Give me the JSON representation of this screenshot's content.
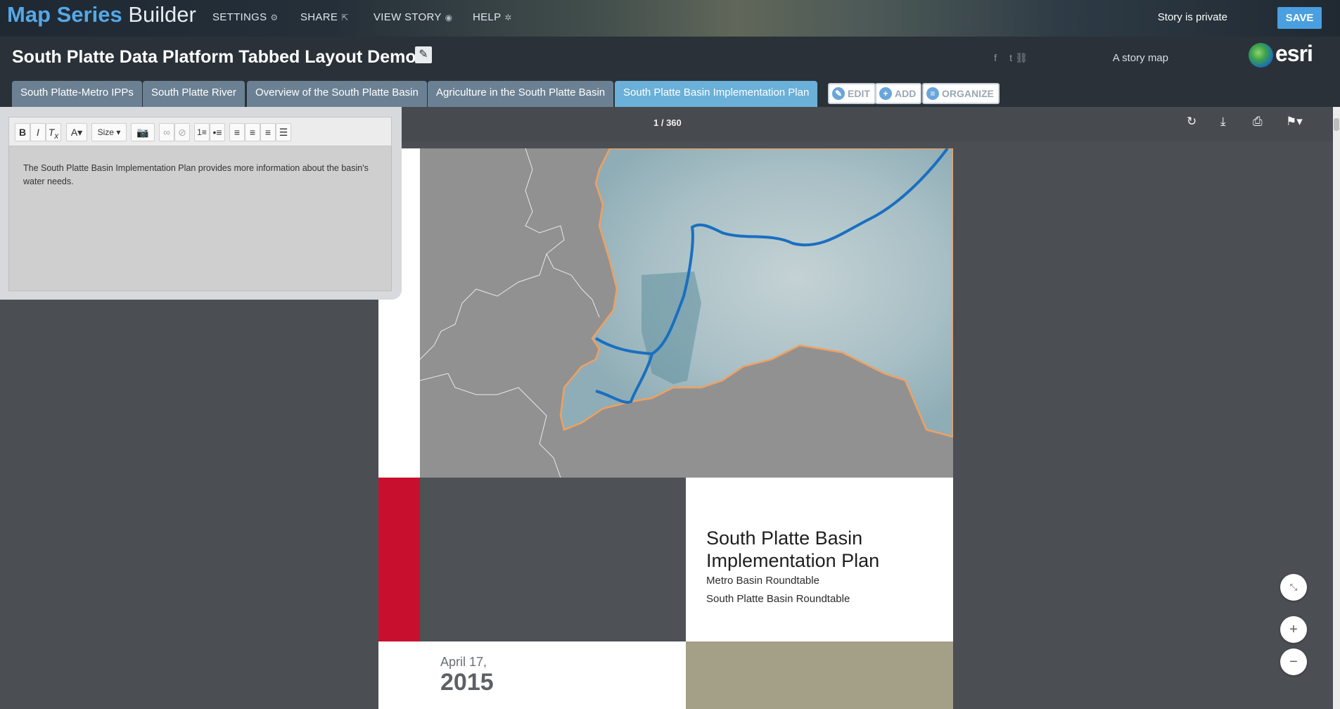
{
  "builder": {
    "brand_bold": "Map Series",
    "brand_light": "Builder",
    "nav": [
      {
        "label": "SETTINGS",
        "icon": "gears-icon"
      },
      {
        "label": "SHARE",
        "icon": "share-icon"
      },
      {
        "label": "VIEW STORY",
        "icon": "eye-icon"
      },
      {
        "label": "HELP",
        "icon": "lifebuoy-icon"
      }
    ],
    "status": "Story is private",
    "save_label": "SAVE"
  },
  "header": {
    "title": "South Platte Data Platform Tabbed Layout Demo",
    "tagline": "A story map",
    "esri_logo_text": "esri"
  },
  "tabs": [
    {
      "label": "South Platte-Metro IPPs",
      "active": false
    },
    {
      "label": "South Platte River",
      "active": false
    },
    {
      "label": "Overview of the South Platte Basin",
      "active": false
    },
    {
      "label": "Agriculture in the South Platte Basin",
      "active": false
    },
    {
      "label": "South Platte Basin Implementation Plan",
      "active": true
    }
  ],
  "tab_actions": {
    "edit": "EDIT",
    "add": "ADD",
    "organize": "ORGANIZE"
  },
  "editor": {
    "size_label": "Size",
    "text": "The South Platte Basin Implementation Plan provides more information about the basin's water needs."
  },
  "pdf": {
    "page_indicator": "1 / 360",
    "title": "South Platte Basin Implementation Plan",
    "subtitle1": "Metro Basin Roundtable",
    "subtitle2": "South Platte Basin Roundtable",
    "date": "April 17,",
    "year": "2015"
  },
  "colors": {
    "active_tab": "#6ab0d8",
    "tab": "#6b8193",
    "save": "#4a9fe0",
    "red_band": "#c8102e",
    "river": "#1a6fc0",
    "basin_outline": "#f0a060"
  }
}
